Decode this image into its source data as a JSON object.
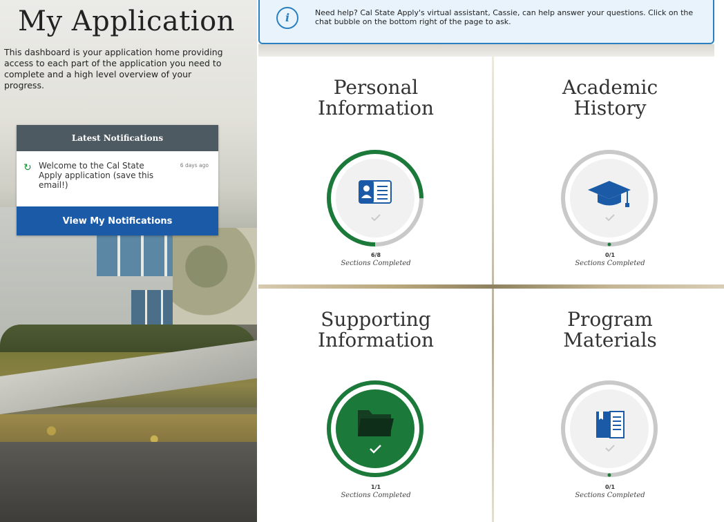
{
  "page": {
    "title": "My Application",
    "intro": "This dashboard is your application home providing access to each part of the application you need to complete and a high level overview of your progress."
  },
  "notifications": {
    "header": "Latest Notifications",
    "item_text": "Welcome to the Cal State Apply application (save this email!)",
    "item_time": "6 days ago",
    "button_label": "View My Notifications",
    "icon": "refresh-arrow-icon"
  },
  "help": {
    "icon": "info-icon",
    "text": "Need help? Cal State Apply's virtual assistant, Cassie, can help answer your questions. Click on the chat bubble on the bottom right of the page to ask."
  },
  "colors": {
    "progress_green": "#1b7a3a",
    "track_gray": "#c9c9c9",
    "primary_blue": "#1a5aa6",
    "header_slate": "#4e5a62"
  },
  "cards": {
    "personal": {
      "title_line1": "Personal",
      "title_line2": "Information",
      "count": "6/8",
      "caption": "Sections Completed",
      "completed": 6,
      "total": 8,
      "icon": "id-card-icon"
    },
    "academic": {
      "title_line1": "Academic",
      "title_line2": "History",
      "count": "0/1",
      "caption": "Sections Completed",
      "completed": 0,
      "total": 1,
      "icon": "graduation-cap-icon"
    },
    "supporting": {
      "title_line1": "Supporting",
      "title_line2": "Information",
      "count": "1/1",
      "caption": "Sections Completed",
      "completed": 1,
      "total": 1,
      "icon": "folder-icon"
    },
    "program": {
      "title_line1": "Program",
      "title_line2": "Materials",
      "count": "0/1",
      "caption": "Sections Completed",
      "completed": 0,
      "total": 1,
      "icon": "book-icon"
    }
  }
}
